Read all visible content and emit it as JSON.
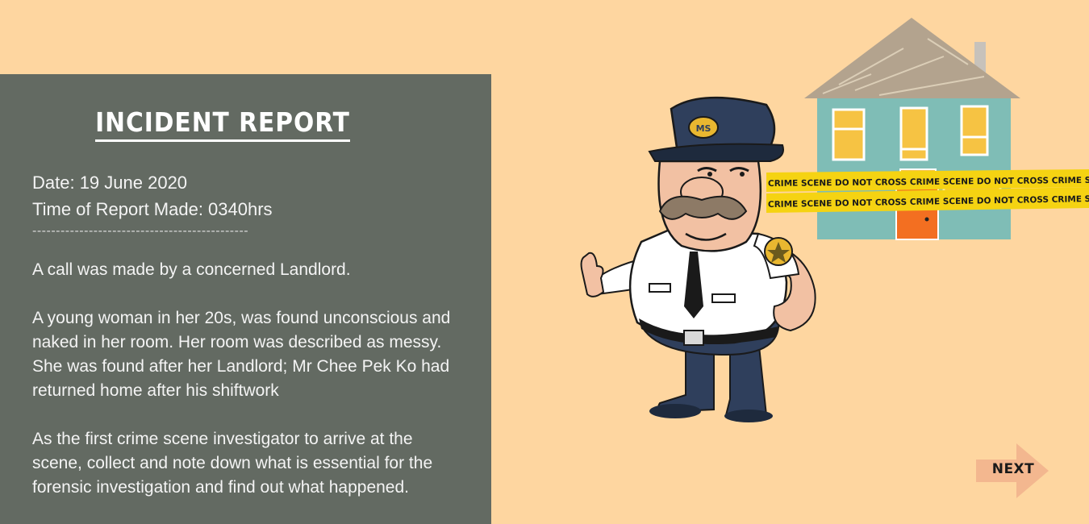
{
  "report": {
    "title": "INCIDENT REPORT",
    "date": "Date: 19 June 2020",
    "time": "Time of Report Made: 0340hrs",
    "divider": "----------------------------------------------",
    "paragraphs": [
      "A call was made by a concerned Landlord.",
      "A young woman in her 20s, was found unconscious and naked in her room.  Her room was described as messy. She was found after her Landlord; Mr Chee Pek Ko had returned home after his shiftwork",
      "As the first crime scene investigator to arrive at the scene, collect and note down what is essential for the forensic investigation and find out what happened."
    ]
  },
  "illustration": {
    "badge_text": "MS",
    "tape_text": "CRIME SCENE DO NOT CROSS CRIME SCENE DO NOT CROSS CRIME SCENE DO NOT CROSS CRIME SCENE DO NOT",
    "icons": [
      "police-officer-illustration",
      "house-illustration",
      "crime-scene-tape"
    ]
  },
  "nav": {
    "next_label": "NEXT"
  },
  "colors": {
    "background": "#fed6a0",
    "panel": "#636a62",
    "house_wall": "#7fbdb6",
    "roof": "#b3a38e",
    "window": "#f6c343",
    "door": "#f36f21",
    "tape": "#f5d312",
    "uniform": "#2f3f5c"
  }
}
